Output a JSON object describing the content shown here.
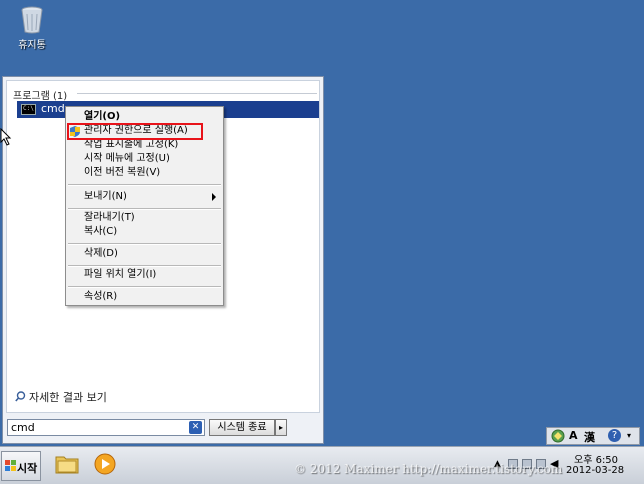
{
  "desktop": {
    "recycle_bin_label": "휴지통"
  },
  "start_menu": {
    "programs_header": "프로그램 (1)",
    "result": {
      "label": "cmd",
      "icon": "cmd-icon"
    },
    "see_more": "자세한 결과 보기",
    "search": {
      "value": "cmd",
      "clear_icon": "clear-icon"
    },
    "shutdown_label": "시스템 종료",
    "shutdown_arrow": "▸"
  },
  "context_menu": {
    "items": [
      {
        "label": "열기(O)",
        "bold": true
      },
      {
        "label": "관리자 권한으로 실행(A)",
        "icon": "uac-shield-icon",
        "highlighted": true
      },
      {
        "label": "작업 표시줄에 고정(K)"
      },
      {
        "label": "시작 메뉴에 고정(U)"
      },
      {
        "label": "이전 버전 복원(V)"
      },
      {
        "label": "보내기(N)",
        "submenu": true
      },
      {
        "label": "잘라내기(T)"
      },
      {
        "label": "복사(C)"
      },
      {
        "label": "삭제(D)"
      },
      {
        "label": "파일 위치 열기(I)"
      },
      {
        "label": "속성(R)"
      }
    ],
    "highlight_color": "#e8131a"
  },
  "language_bar": {
    "mode": "A",
    "hanja": "漢",
    "help": "?"
  },
  "taskbar": {
    "start_label": "시작",
    "quick_launch": [
      "explorer-icon",
      "media-player-icon"
    ],
    "tray_chevron": "▲",
    "clock_time": "오후 6:50",
    "clock_date": "2012-03-28"
  },
  "watermark": "© 2012 Maximer http://maximer.tistory.com",
  "colors": {
    "desktop": "#3b6ba8",
    "selection": "#1b3f8f",
    "highlight_box": "#e8131a"
  }
}
